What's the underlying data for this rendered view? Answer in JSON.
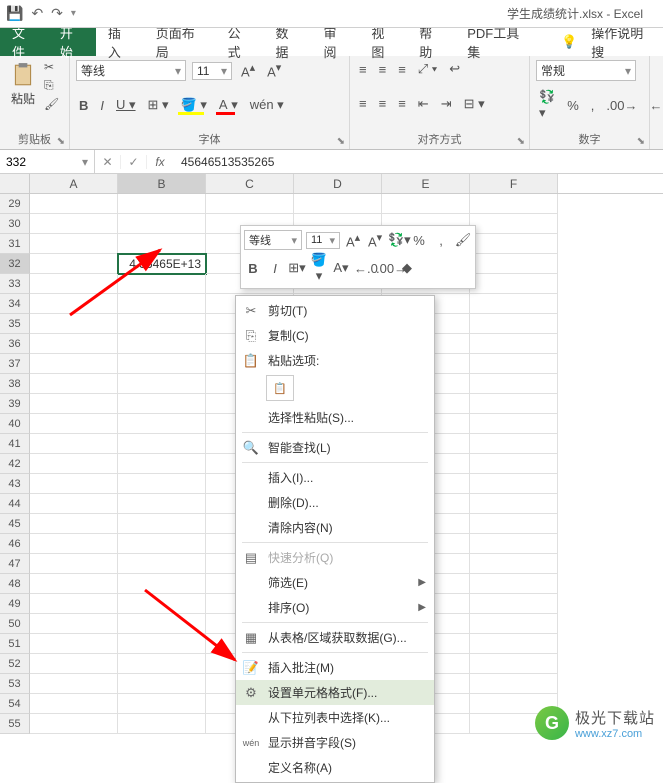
{
  "titlebar": {
    "doc_title": "学生成绩统计.xlsx - Excel"
  },
  "tabs": {
    "file": "文件",
    "home": "开始",
    "insert": "插入",
    "layout": "页面布局",
    "formulas": "公式",
    "data": "数据",
    "review": "审阅",
    "view": "视图",
    "help": "帮助",
    "pdf": "PDF工具集",
    "tellme": "操作说明搜"
  },
  "ribbon": {
    "clipboard": {
      "label": "剪贴板",
      "paste": "粘贴"
    },
    "font": {
      "label": "字体",
      "name": "等线",
      "size": "11"
    },
    "align": {
      "label": "对齐方式"
    },
    "number": {
      "label": "数字",
      "format": "常规"
    }
  },
  "namebox": "332",
  "formula": "45646513535265",
  "columns": [
    "A",
    "B",
    "C",
    "D",
    "E",
    "F"
  ],
  "row_start": 29,
  "sel_cell_value": "4.56465E+13",
  "mini": {
    "font": "等线",
    "size": "11"
  },
  "ctx": {
    "cut": "剪切(T)",
    "copy": "复制(C)",
    "paste_options": "粘贴选项:",
    "paste_special": "选择性粘贴(S)...",
    "smart_lookup": "智能查找(L)",
    "insert": "插入(I)...",
    "delete": "删除(D)...",
    "clear": "清除内容(N)",
    "quick_analysis": "快速分析(Q)",
    "filter": "筛选(E)",
    "sort": "排序(O)",
    "from_table": "从表格/区域获取数据(G)...",
    "insert_comment": "插入批注(M)",
    "format_cells": "设置单元格格式(F)...",
    "pick_list": "从下拉列表中选择(K)...",
    "phonetic": "显示拼音字段(S)",
    "define_name": "定义名称(A)"
  },
  "watermark": {
    "cn": "极光下载站",
    "url": "www.xz7.com"
  }
}
